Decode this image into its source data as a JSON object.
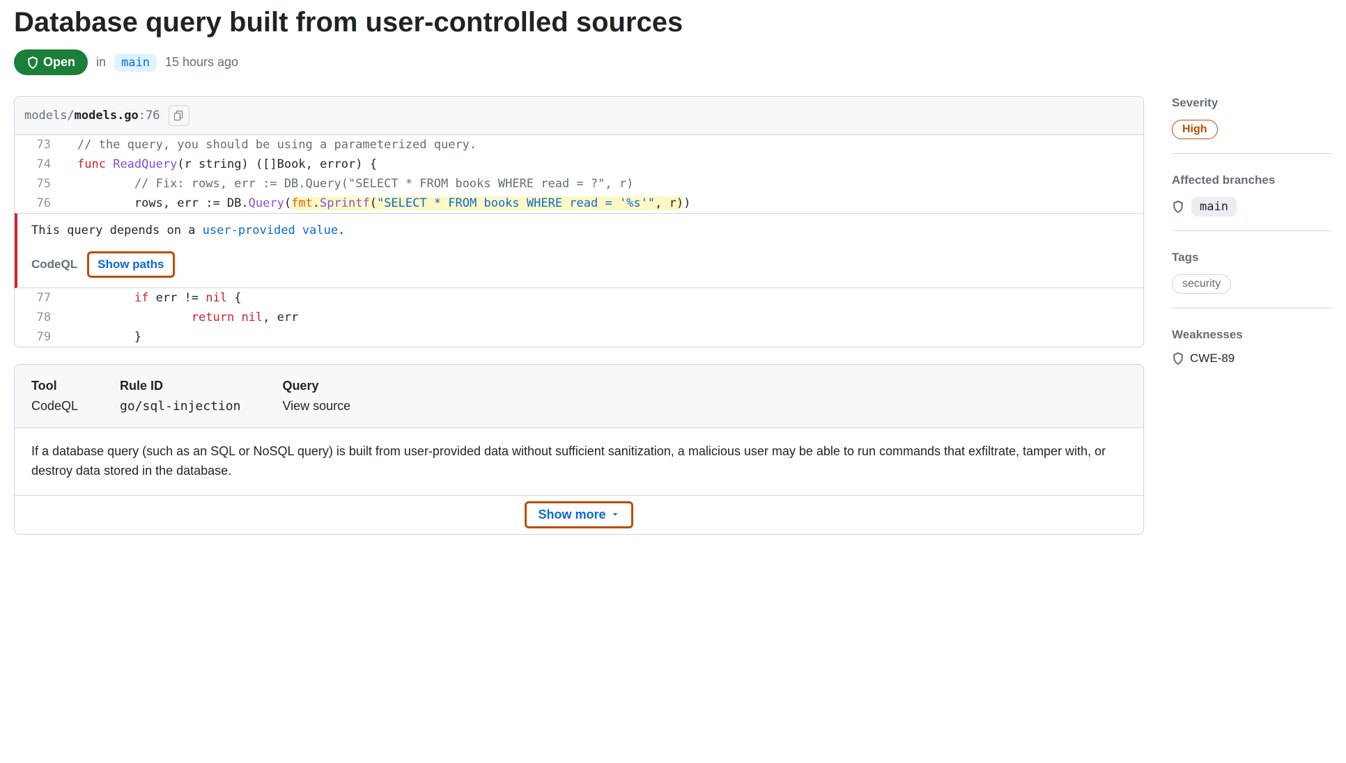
{
  "title": "Database query built from user-controlled sources",
  "status": {
    "label": "Open",
    "in_text": "in",
    "branch": "main",
    "timestamp": "15 hours ago"
  },
  "code": {
    "file_prefix": "models/",
    "file_name": "models.go",
    "file_suffix": ":76",
    "lines_before": [
      {
        "num": "73",
        "tokens": [
          {
            "cls": "tok-comment",
            "text": "// the query, you should be using a parameterized query."
          }
        ]
      },
      {
        "num": "74",
        "tokens": [
          {
            "cls": "tok-keyword",
            "text": "func"
          },
          {
            "cls": "tok-plain",
            "text": " "
          },
          {
            "cls": "tok-func",
            "text": "ReadQuery"
          },
          {
            "cls": "tok-plain",
            "text": "(r "
          },
          {
            "cls": "tok-type",
            "text": "string"
          },
          {
            "cls": "tok-plain",
            "text": ") ([]Book, "
          },
          {
            "cls": "tok-type",
            "text": "error"
          },
          {
            "cls": "tok-plain",
            "text": ") {"
          }
        ]
      },
      {
        "num": "75",
        "tokens": [
          {
            "cls": "tok-plain",
            "text": "        "
          },
          {
            "cls": "tok-comment",
            "text": "// Fix: rows, err := DB.Query(\"SELECT * FROM books WHERE read = ?\", r)"
          }
        ]
      },
      {
        "num": "76",
        "tokens": [
          {
            "cls": "tok-plain",
            "text": "        rows, err := DB."
          },
          {
            "cls": "tok-func",
            "text": "Query"
          },
          {
            "cls": "tok-plain",
            "text": "("
          },
          {
            "cls": "tok-orange hlspan",
            "text": "fmt"
          },
          {
            "cls": "tok-plain hlspan",
            "text": "."
          },
          {
            "cls": "tok-func hlspan",
            "text": "Sprintf"
          },
          {
            "cls": "tok-plain hlspan",
            "text": "("
          },
          {
            "cls": "tok-blue hlspan",
            "text": "\"SELECT * FROM books WHERE read = '%s'\""
          },
          {
            "cls": "tok-plain hlspan",
            "text": ", r)"
          },
          {
            "cls": "tok-plain",
            "text": ")"
          }
        ]
      }
    ],
    "alert": {
      "msg_prefix": "This query depends on a ",
      "msg_link": "user-provided value",
      "msg_suffix": ".",
      "tool": "CodeQL",
      "show_paths": "Show paths"
    },
    "lines_after": [
      {
        "num": "77",
        "tokens": [
          {
            "cls": "tok-plain",
            "text": "        "
          },
          {
            "cls": "tok-keyword",
            "text": "if"
          },
          {
            "cls": "tok-plain",
            "text": " err != "
          },
          {
            "cls": "tok-keyword",
            "text": "nil"
          },
          {
            "cls": "tok-plain",
            "text": " {"
          }
        ]
      },
      {
        "num": "78",
        "tokens": [
          {
            "cls": "tok-plain",
            "text": "                "
          },
          {
            "cls": "tok-keyword",
            "text": "return"
          },
          {
            "cls": "tok-plain",
            "text": " "
          },
          {
            "cls": "tok-keyword",
            "text": "nil"
          },
          {
            "cls": "tok-plain",
            "text": ", err"
          }
        ]
      },
      {
        "num": "79",
        "tokens": [
          {
            "cls": "tok-plain",
            "text": "        }"
          }
        ]
      }
    ]
  },
  "details": {
    "tool_label": "Tool",
    "tool_value": "CodeQL",
    "rule_label": "Rule ID",
    "rule_value": "go/sql-injection",
    "query_label": "Query",
    "query_link": "View source",
    "description": "If a database query (such as an SQL or NoSQL query) is built from user-provided data without sufficient sanitization, a malicious user may be able to run commands that exfiltrate, tamper with, or destroy data stored in the database.",
    "show_more": "Show more"
  },
  "sidebar": {
    "severity_heading": "Severity",
    "severity_value": "High",
    "branches_heading": "Affected branches",
    "branch_value": "main",
    "tags_heading": "Tags",
    "tag_value": "security",
    "weaknesses_heading": "Weaknesses",
    "weakness_value": "CWE-89"
  }
}
